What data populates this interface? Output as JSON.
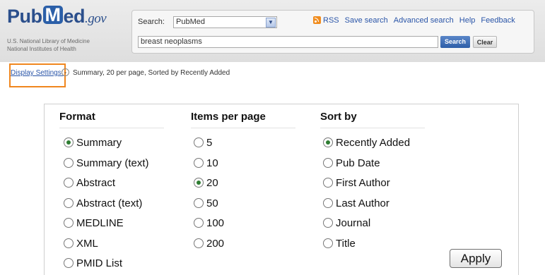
{
  "logo": {
    "pub": "Pub",
    "m": "M",
    "ed": "ed",
    "gov": ".gov",
    "line1": "U.S. National Library of Medicine",
    "line2": "National Institutes of Health"
  },
  "search": {
    "label": "Search:",
    "database": "PubMed",
    "term": "breast neoplasms",
    "search_label": "Search",
    "clear_label": "Clear"
  },
  "toplinks": [
    "RSS",
    "Save search",
    "Advanced search",
    "Help",
    "Feedback"
  ],
  "display": {
    "link": "Display Settings:",
    "toggle_icon": "⌄",
    "summary": "Summary, 20 per page, Sorted by Recently Added"
  },
  "format": {
    "heading": "Format",
    "options": [
      "Summary",
      "Summary (text)",
      "Abstract",
      "Abstract (text)",
      "MEDLINE",
      "XML",
      "PMID List"
    ],
    "selected": 0
  },
  "items_per_page": {
    "heading": "Items per page",
    "options": [
      "5",
      "10",
      "20",
      "50",
      "100",
      "200"
    ],
    "selected": 2
  },
  "sort_by": {
    "heading": "Sort by",
    "options": [
      "Recently Added",
      "Pub Date",
      "First Author",
      "Last Author",
      "Journal",
      "Title"
    ],
    "selected": 0
  },
  "apply_label": "Apply",
  "colors": {
    "brand_blue": "#2b4f8c",
    "link_blue": "#2a55a8",
    "highlight_orange": "#f0861e",
    "radio_selected": "#2e7d32"
  }
}
